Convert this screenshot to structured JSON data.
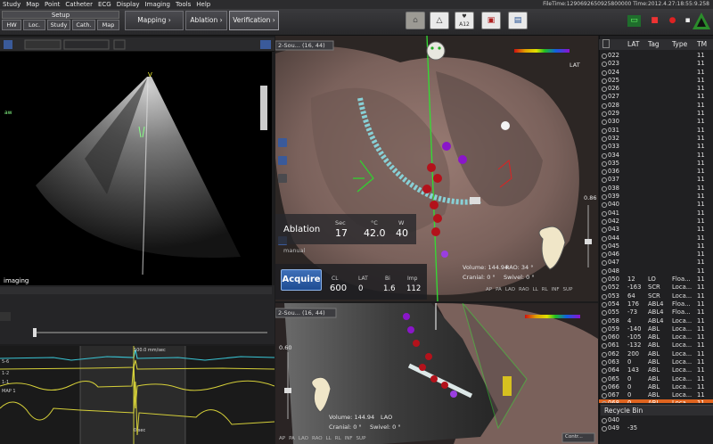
{
  "menu": [
    "Study",
    "Map",
    "Point",
    "Catheter",
    "ECG",
    "Display",
    "Imaging",
    "Tools",
    "Help"
  ],
  "file_info": "FileTime:1290692650925800000 Time:2012.4.27:18:55:9.258",
  "setup": {
    "title": "Setup",
    "buttons": [
      "HW",
      "Loc.",
      "Study",
      "Cath.",
      "Map"
    ]
  },
  "workflow": {
    "mapping": "Mapping ›",
    "ablation": "Ablation ›",
    "verification": "Verification ›"
  },
  "toolbar_icons": [
    "camera-icon",
    "map-shell-icon",
    "heart-icon",
    "export-icon",
    "screen-icon"
  ],
  "toolbar_badge": "A12",
  "echo": {
    "label_top": "V",
    "label_side": "imaging",
    "label_left": "aw"
  },
  "ecg": {
    "speed": "100.0 mm/sec",
    "time_zero": "0 sec",
    "leads": [
      "5-6",
      "1-2",
      "1-1",
      "MAP 1"
    ]
  },
  "view_main": {
    "tag": "2-Sou... (16, 44)",
    "lat_label": "LAT",
    "volume": "144.94",
    "rao_label": "RAO:",
    "rao_value": "34 °",
    "cranial_label": "Cranial:",
    "cranial_value": "0 °",
    "swivel_label": "Swivel:",
    "swivel_value": "0 °",
    "zoom": "0.86",
    "orient_buttons": [
      "AP",
      "PA",
      "LAO",
      "RAO",
      "LL",
      "RL",
      "INF",
      "SUP"
    ]
  },
  "ablation": {
    "title": "Ablation",
    "manual": "manual",
    "sec_label": "Sec",
    "sec_value": "17",
    "temp_label": "°C",
    "temp_value": "42.0",
    "watt_label": "W",
    "watt_value": "40"
  },
  "acquire": {
    "button": "Acquire",
    "headers": [
      "CL",
      "LAT",
      "Bi",
      "Imp"
    ],
    "values": [
      "600",
      "0",
      "1.6",
      "112"
    ]
  },
  "view_second": {
    "tag": "2-Sou... (16, 44)",
    "zoom": "0.60",
    "volume": "144.94",
    "lao_label": "LAO",
    "cranial_label": "Cranial:",
    "cranial_value": "0 °",
    "swivel_label": "Swivel:",
    "swivel_value": "0 °",
    "orient_buttons": [
      "AP",
      "PA",
      "LAO",
      "RAO",
      "LL",
      "RL",
      "INF",
      "SUP"
    ],
    "corner_btn": "Contr..."
  },
  "points": {
    "columns": [
      "LAT",
      "Tag",
      "Type",
      "TM"
    ],
    "rows": [
      {
        "id": "022",
        "lat": "",
        "tag": "",
        "type": "",
        "tm": "11"
      },
      {
        "id": "023",
        "lat": "",
        "tag": "",
        "type": "",
        "tm": "11"
      },
      {
        "id": "024",
        "lat": "",
        "tag": "",
        "type": "",
        "tm": "11"
      },
      {
        "id": "025",
        "lat": "",
        "tag": "",
        "type": "",
        "tm": "11"
      },
      {
        "id": "026",
        "lat": "",
        "tag": "",
        "type": "",
        "tm": "11"
      },
      {
        "id": "027",
        "lat": "",
        "tag": "",
        "type": "",
        "tm": "11"
      },
      {
        "id": "028",
        "lat": "",
        "tag": "",
        "type": "",
        "tm": "11"
      },
      {
        "id": "029",
        "lat": "",
        "tag": "",
        "type": "",
        "tm": "11"
      },
      {
        "id": "030",
        "lat": "",
        "tag": "",
        "type": "",
        "tm": "11"
      },
      {
        "id": "031",
        "lat": "",
        "tag": "",
        "type": "",
        "tm": "11"
      },
      {
        "id": "032",
        "lat": "",
        "tag": "",
        "type": "",
        "tm": "11"
      },
      {
        "id": "033",
        "lat": "",
        "tag": "",
        "type": "",
        "tm": "11"
      },
      {
        "id": "034",
        "lat": "",
        "tag": "",
        "type": "",
        "tm": "11"
      },
      {
        "id": "035",
        "lat": "",
        "tag": "",
        "type": "",
        "tm": "11"
      },
      {
        "id": "036",
        "lat": "",
        "tag": "",
        "type": "",
        "tm": "11"
      },
      {
        "id": "037",
        "lat": "",
        "tag": "",
        "type": "",
        "tm": "11"
      },
      {
        "id": "038",
        "lat": "",
        "tag": "",
        "type": "",
        "tm": "11"
      },
      {
        "id": "039",
        "lat": "",
        "tag": "",
        "type": "",
        "tm": "11"
      },
      {
        "id": "040",
        "lat": "",
        "tag": "",
        "type": "",
        "tm": "11"
      },
      {
        "id": "041",
        "lat": "",
        "tag": "",
        "type": "",
        "tm": "11"
      },
      {
        "id": "042",
        "lat": "",
        "tag": "",
        "type": "",
        "tm": "11"
      },
      {
        "id": "043",
        "lat": "",
        "tag": "",
        "type": "",
        "tm": "11"
      },
      {
        "id": "044",
        "lat": "",
        "tag": "",
        "type": "",
        "tm": "11"
      },
      {
        "id": "045",
        "lat": "",
        "tag": "",
        "type": "",
        "tm": "11"
      },
      {
        "id": "046",
        "lat": "",
        "tag": "",
        "type": "",
        "tm": "11"
      },
      {
        "id": "047",
        "lat": "",
        "tag": "",
        "type": "",
        "tm": "11"
      },
      {
        "id": "048",
        "lat": "",
        "tag": "",
        "type": "",
        "tm": "11"
      },
      {
        "id": "050",
        "lat": "12",
        "tag": "LO",
        "type": "Floa...",
        "tm": "11"
      },
      {
        "id": "052",
        "lat": "-163",
        "tag": "SCR",
        "type": "Loca...",
        "tm": "11"
      },
      {
        "id": "053",
        "lat": "64",
        "tag": "SCR",
        "type": "Loca...",
        "tm": "11"
      },
      {
        "id": "054",
        "lat": "176",
        "tag": "ABL4",
        "type": "Floa...",
        "tm": "11"
      },
      {
        "id": "055",
        "lat": "-73",
        "tag": "ABL4",
        "type": "Floa...",
        "tm": "11"
      },
      {
        "id": "058",
        "lat": "4",
        "tag": "ABL4",
        "type": "Loca...",
        "tm": "11"
      },
      {
        "id": "059",
        "lat": "-140",
        "tag": "ABL",
        "type": "Loca...",
        "tm": "11"
      },
      {
        "id": "060",
        "lat": "-105",
        "tag": "ABL",
        "type": "Loca...",
        "tm": "11"
      },
      {
        "id": "061",
        "lat": "-132",
        "tag": "ABL",
        "type": "Loca...",
        "tm": "11"
      },
      {
        "id": "062",
        "lat": "200",
        "tag": "ABL",
        "type": "Loca...",
        "tm": "11"
      },
      {
        "id": "063",
        "lat": "0",
        "tag": "ABL",
        "type": "Loca...",
        "tm": "11"
      },
      {
        "id": "064",
        "lat": "143",
        "tag": "ABL",
        "type": "Loca...",
        "tm": "11"
      },
      {
        "id": "065",
        "lat": "0",
        "tag": "ABL",
        "type": "Loca...",
        "tm": "11"
      },
      {
        "id": "066",
        "lat": "0",
        "tag": "ABL",
        "type": "Loca...",
        "tm": "11"
      },
      {
        "id": "067",
        "lat": "0",
        "tag": "ABL",
        "type": "Loca...",
        "tm": "11"
      },
      {
        "id": "068",
        "lat": "0",
        "tag": "ABL",
        "type": "Loca...",
        "tm": "11"
      }
    ],
    "selected_id": "068"
  },
  "recycle": {
    "title": "Recycle Bin",
    "rows": [
      {
        "id": "040",
        "lat": "",
        "tag": "",
        "type": "",
        "tm": ""
      },
      {
        "id": "049",
        "lat": "-35",
        "tag": "",
        "type": "",
        "tm": ""
      }
    ]
  },
  "colors": {
    "accent": "#e0641f",
    "acquire": "#2a5ea8",
    "lesion": "#b3121b",
    "purple": "#8a16c9"
  }
}
